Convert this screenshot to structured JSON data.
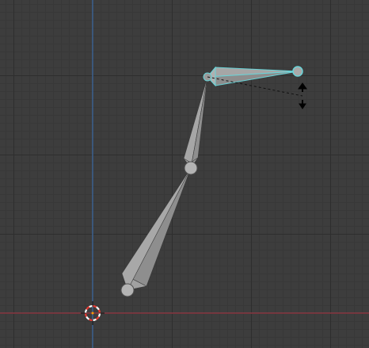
{
  "viewport": {
    "editor": "3d-viewport",
    "mode": "bone-roll-rotate",
    "colors": {
      "background": "#3d3d3d",
      "grid_major": "#2e2e2e",
      "grid_minor": "#383838",
      "axis_x": "#9b3a45",
      "axis_y": "#3f6fa8",
      "bone": "#a1a1a1",
      "bone_joint": "#b3b3b3",
      "bone_selected_outline": "#69d4d8",
      "cursor_ring_red": "#e83a32",
      "cursor_ring_white": "#ffffff"
    },
    "icons": {
      "cursor": "3d-cursor-icon",
      "rotate_handle": "rotate-arrows-icon"
    },
    "bones": [
      {
        "name": "bone-lower",
        "selected": false
      },
      {
        "name": "bone-middle",
        "selected": false
      },
      {
        "name": "bone-upper-selected",
        "selected": true
      }
    ]
  }
}
